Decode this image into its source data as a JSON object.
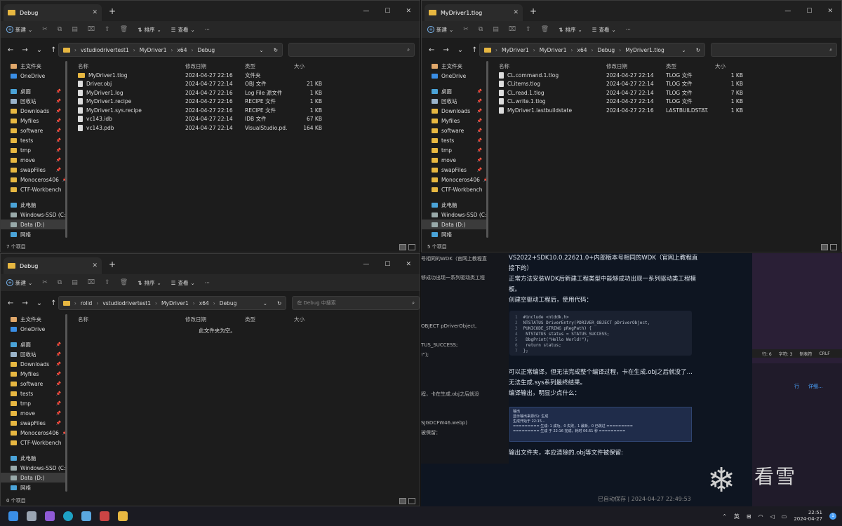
{
  "toolbar": {
    "new": "新建",
    "sort": "排序",
    "view": "查看",
    "more": "···"
  },
  "sidebar_items": [
    {
      "label": "主文件夹",
      "pin": false
    },
    {
      "label": "OneDrive",
      "pin": false
    },
    {
      "label": "",
      "gap": true
    },
    {
      "label": "桌面",
      "pin": true
    },
    {
      "label": "回收站",
      "pin": true
    },
    {
      "label": "Downloads",
      "pin": true
    },
    {
      "label": "Myfiles",
      "pin": true
    },
    {
      "label": "software",
      "pin": true
    },
    {
      "label": "tests",
      "pin": true
    },
    {
      "label": "tmp",
      "pin": true
    },
    {
      "label": "move",
      "pin": true
    },
    {
      "label": "swapFiles",
      "pin": true
    },
    {
      "label": "Monoceros406",
      "pin": true
    },
    {
      "label": "CTF-Workbench",
      "pin": true
    },
    {
      "label": "",
      "gap": true
    },
    {
      "label": "此电脑",
      "pin": false
    },
    {
      "label": "Windows-SSD (C:)",
      "pin": false
    },
    {
      "label": "Data (D:)",
      "pin": false
    },
    {
      "label": "网络",
      "pin": false
    }
  ],
  "columns": {
    "name": "名称",
    "modified": "修改日期",
    "type": "类型",
    "size": "大小"
  },
  "win1": {
    "tab": "Debug",
    "path": [
      "vstudiodrivertest1",
      "MyDriver1",
      "x64",
      "Debug"
    ],
    "search_placeholder": "",
    "files": [
      {
        "name": "MyDriver1.tlog",
        "date": "2024-04-27 22:16",
        "type": "文件夹",
        "size": "",
        "folder": true
      },
      {
        "name": "Driver.obj",
        "date": "2024-04-27 22:14",
        "type": "OBJ 文件",
        "size": "21 KB"
      },
      {
        "name": "MyDriver1.log",
        "date": "2024-04-27 22:16",
        "type": "Log File 源文件",
        "size": "1 KB"
      },
      {
        "name": "MyDriver1.recipe",
        "date": "2024-04-27 22:16",
        "type": "RECIPE 文件",
        "size": "1 KB"
      },
      {
        "name": "MyDriver1.sys.recipe",
        "date": "2024-04-27 22:16",
        "type": "RECIPE 文件",
        "size": "1 KB"
      },
      {
        "name": "vc143.idb",
        "date": "2024-04-27 22:14",
        "type": "IDB 文件",
        "size": "67 KB"
      },
      {
        "name": "vc143.pdb",
        "date": "2024-04-27 22:14",
        "type": "VisualStudio.pd...",
        "size": "164 KB"
      }
    ],
    "status": "7 个项目"
  },
  "win2": {
    "tab": "MyDriver1.tlog",
    "path": [
      "MyDriver1",
      "MyDriver1",
      "x64",
      "Debug",
      "MyDriver1.tlog"
    ],
    "search_placeholder": "",
    "files": [
      {
        "name": "CL.command.1.tlog",
        "date": "2024-04-27 22:14",
        "type": "TLOG 文件",
        "size": "1 KB"
      },
      {
        "name": "CLitems.tlog",
        "date": "2024-04-27 22:14",
        "type": "TLOG 文件",
        "size": "1 KB"
      },
      {
        "name": "CL.read.1.tlog",
        "date": "2024-04-27 22:14",
        "type": "TLOG 文件",
        "size": "7 KB"
      },
      {
        "name": "CL.write.1.tlog",
        "date": "2024-04-27 22:14",
        "type": "TLOG 文件",
        "size": "1 KB"
      },
      {
        "name": "MyDriver1.lastbuildstate",
        "date": "2024-04-27 22:16",
        "type": "LASTBUILDSTAT...",
        "size": "1 KB"
      }
    ],
    "status": "5 个项目"
  },
  "win3": {
    "tab": "Debug",
    "path": [
      "rolid",
      "vstudiodrivertest1",
      "MyDriver1",
      "x64",
      "Debug"
    ],
    "search_placeholder": "在 Debug 中搜索",
    "empty": "此文件夹为空。",
    "status": "0 个项目"
  },
  "article": {
    "p1": "VS2022+SDK10.0.22621.0+内部版本号相同的WDK（官网上教程直接下的）",
    "p2": "正常方法安装WDK后新建工程类型中能够成功出现一系列驱动类工程模板。",
    "p3": "创建空驱动工程后，使用代码：",
    "code": [
      "#include <ntddk.h>",
      "NTSTATUS DriverEntry(PDRIVER_OBJECT pDriverObject,",
      "PUNICODE_STRING pRegPath) {",
      "    NTSTATUS status = STATUS_SUCCESS;",
      "    DbgPrint(\"Hello World!\");",
      "    return status;",
      "};"
    ],
    "p4": "可以正常编译，但无法完成整个编译过程，卡在生成.obj之后就没了...无法生成.sys系列最终结果。",
    "p5": "编译输出，明显少点什么：",
    "out_title": "输出",
    "out_source": "显示输出来源(S): 生成",
    "out_lines": [
      "生成开始于 22:15...",
      "========= 生成: 1 成功，0 失败，1 最新，0 已跳过 =========",
      "========= 生成 于 22:16 完成，耗时 06.61 秒 ========="
    ],
    "p6": "输出文件夹，本应清除的.obj等文件被保留:",
    "autosave": "已自动保存 | 2024-04-27 22:49:53",
    "left_frag": [
      "号相同的WDK（官网上教程直",
      "够成功出现一系列驱动类工程",
      "OBJECT pDriverObject,",
      "TUS_SUCCESS;",
      "!\");",
      "程，卡在生成.obj之后就没",
      "SJGDCFW46.webp)",
      "被保留："
    ],
    "status_right": [
      "行: 6",
      "字符: 3",
      "制表符",
      "CRLF"
    ],
    "right_links": [
      "行",
      "详细..."
    ],
    "watermark": "看雪"
  },
  "taskbar": {
    "ime": "英",
    "time": "22:51",
    "date": "2024-04-27",
    "notif": "1"
  }
}
